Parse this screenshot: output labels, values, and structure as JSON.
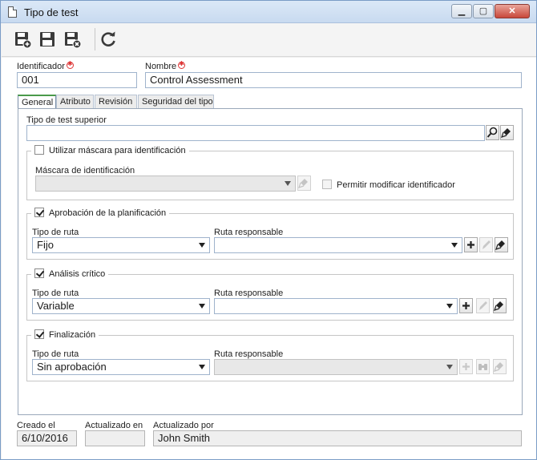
{
  "window": {
    "title": "Tipo de test",
    "min_glyph": "▁",
    "max_glyph": "▢",
    "close_glyph": "✕"
  },
  "toolbar": {
    "buttons": [
      "save-and-new-icon",
      "save-icon",
      "save-and-close-icon",
      "refresh-icon"
    ]
  },
  "fields": {
    "identificador_label": "Identificador",
    "identificador_value": "001",
    "nombre_label": "Nombre",
    "nombre_value": "Control Assessment"
  },
  "tabs": [
    {
      "label": "General",
      "active": true
    },
    {
      "label": "Atributo",
      "active": false
    },
    {
      "label": "Revisión",
      "active": false
    },
    {
      "label": "Seguridad del tipo",
      "active": false
    }
  ],
  "general": {
    "tipo_superior_label": "Tipo de test superior",
    "tipo_superior_value": "",
    "mascara_group": {
      "legend": "Utilizar máscara para identificación",
      "checked": false,
      "mascara_label": "Máscara de identificación",
      "mascara_value": "",
      "permitir_label": "Permitir modificar identificador",
      "permitir_checked": false
    },
    "aprobacion": {
      "legend": "Aprobación de la planificación",
      "checked": true,
      "tipo_ruta_label": "Tipo de ruta",
      "tipo_ruta_value": "Fijo",
      "ruta_responsable_label": "Ruta responsable",
      "ruta_responsable_value": ""
    },
    "analisis": {
      "legend": "Análisis crítico",
      "checked": true,
      "tipo_ruta_label": "Tipo de ruta",
      "tipo_ruta_value": "Variable",
      "ruta_responsable_label": "Ruta responsable",
      "ruta_responsable_value": ""
    },
    "finalizacion": {
      "legend": "Finalización",
      "checked": true,
      "tipo_ruta_label": "Tipo de ruta",
      "tipo_ruta_value": "Sin aprobación",
      "ruta_responsable_label": "Ruta responsable",
      "ruta_responsable_value": ""
    }
  },
  "footer": {
    "creado_label": "Creado el",
    "creado_value": "6/10/2016",
    "actualizado_label": "Actualizado en",
    "actualizado_value": "",
    "actualizado_por_label": "Actualizado por",
    "actualizado_por_value": "John Smith"
  },
  "colors": {
    "accent_tab": "#4a9a4a",
    "required": "#d33333",
    "titlebar": "#c8daf0"
  }
}
